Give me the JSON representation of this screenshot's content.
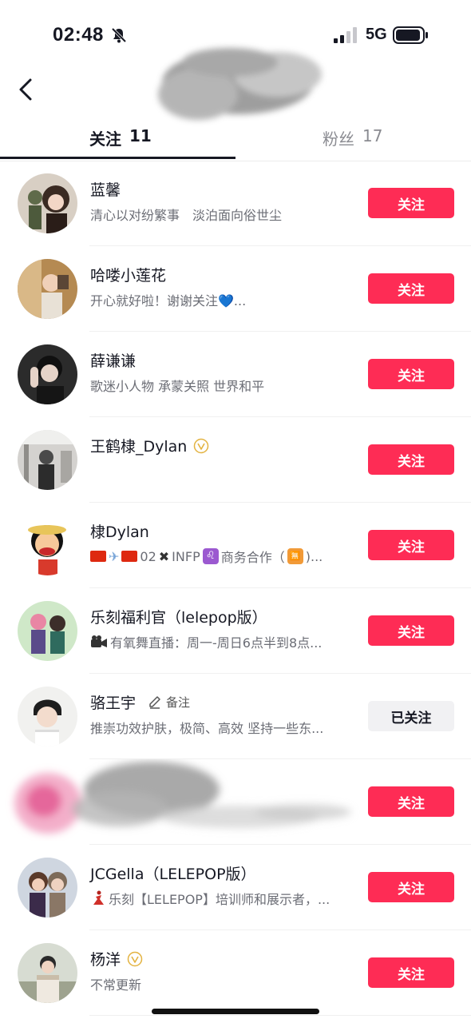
{
  "status_bar": {
    "time": "02:48",
    "network": "5G"
  },
  "tabs": {
    "following": {
      "label": "关注",
      "count": "11"
    },
    "fans": {
      "label": "粉丝",
      "count": "17"
    }
  },
  "colors": {
    "accent": "#fe2c55",
    "followed_bg": "#f1f1f3"
  },
  "users": [
    {
      "name": "蓝馨",
      "bio": "清心以对纷繁事　淡泊面向俗世尘",
      "button": "关注"
    },
    {
      "name": "哈喽小莲花",
      "bio": "开心就好啦！谢谢关注💙...",
      "button": "关注"
    },
    {
      "name": "薛谦谦",
      "bio": "歌迷小人物 承蒙关照 世界和平",
      "button": "关注"
    },
    {
      "name": "王鹤棣_Dylan",
      "bio": "",
      "button": "关注",
      "verified": true
    },
    {
      "name": "棣Dylan",
      "bio_parts": [
        "02",
        "✖",
        "INFP",
        "♌",
        "商务合作（",
        "🈚",
        ")..."
      ],
      "button": "关注"
    },
    {
      "name": "乐刻福利官（lelepop版）",
      "bio": "有氧舞直播：周一-周日6点半到8点...",
      "button": "关注",
      "bio_icon": "video-camera-icon"
    },
    {
      "name": "骆王宇",
      "remark": "备注",
      "bio": "推崇功效护肤，极简、高效 坚持一些东...",
      "button": "已关注",
      "followed": true
    },
    {
      "name": "",
      "bio": "",
      "button": "关注",
      "redacted": true
    },
    {
      "name": "JCGella（LELEPOP版）",
      "bio": "乐刻【LELEPOP】培训师和展示者，...",
      "button": "关注",
      "bio_icon": "dancer-icon"
    },
    {
      "name": "杨洋",
      "bio": "不常更新",
      "button": "关注",
      "verified": true
    }
  ]
}
